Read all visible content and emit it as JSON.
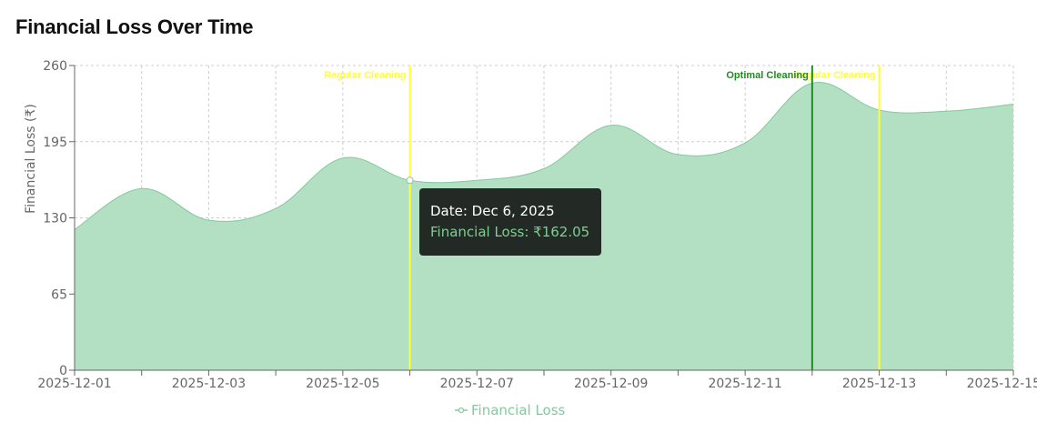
{
  "chart_data": {
    "type": "area",
    "title": "Financial Loss Over Time",
    "ylabel": "Financial Loss (₹)",
    "xlabel": "",
    "ylim": [
      0,
      260
    ],
    "yticks": [
      0,
      65,
      130,
      195,
      260
    ],
    "x": [
      "2025-12-01",
      "2025-12-02",
      "2025-12-03",
      "2025-12-04",
      "2025-12-05",
      "2025-12-06",
      "2025-12-07",
      "2025-12-08",
      "2025-12-09",
      "2025-12-10",
      "2025-12-11",
      "2025-12-12",
      "2025-12-13",
      "2025-12-14",
      "2025-12-15"
    ],
    "xtick_labels": [
      "2025-12-01",
      "2025-12-03",
      "2025-12-05",
      "2025-12-07",
      "2025-12-09",
      "2025-12-11",
      "2025-12-13",
      "2025-12-15"
    ],
    "series": [
      {
        "name": "Financial Loss",
        "values": [
          120,
          155,
          128,
          138,
          181,
          162.05,
          162,
          172,
          209,
          184,
          194,
          245,
          222,
          221,
          227
        ]
      }
    ],
    "reference_lines": [
      {
        "x": "2025-12-06",
        "label": "Regular Cleaning",
        "color": "#ffff33"
      },
      {
        "x": "2025-12-13",
        "label": "Regular Cleaning",
        "color": "#ffff33"
      },
      {
        "x": "2025-12-12",
        "label": "Optimal Cleaning",
        "color": "#228b22"
      }
    ],
    "grid": true,
    "legend_position": "bottom",
    "colors": {
      "fill": "#b3dfc2",
      "stroke": "#82ca9d",
      "axis": "#666666",
      "grid": "#cccccc"
    },
    "tooltip": {
      "date": "Date: Dec 6, 2025",
      "value": "Financial Loss: ₹162.05"
    }
  }
}
